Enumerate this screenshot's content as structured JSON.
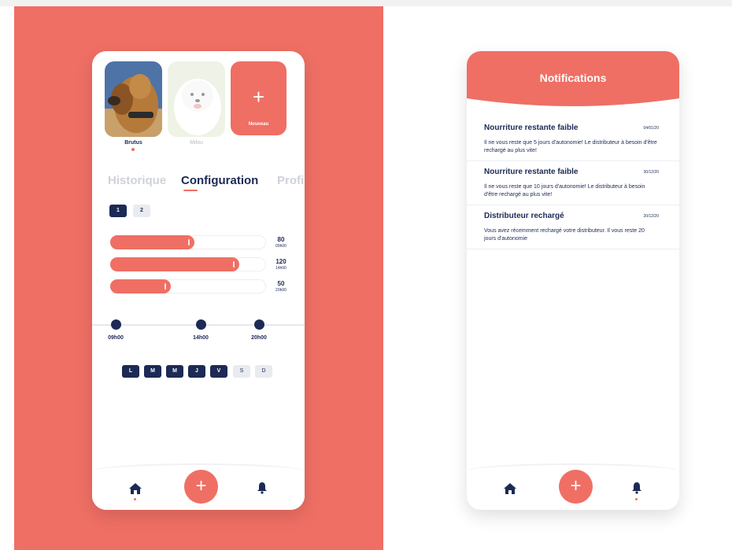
{
  "colors": {
    "accent": "#ef6f64",
    "navy": "#1c2a55",
    "muted": "#cfd2dc"
  },
  "config_screen": {
    "pets": [
      {
        "name": "Brutus",
        "selected": true
      },
      {
        "name": "Milou",
        "selected": false
      }
    ],
    "add_pet": {
      "icon": "plus-icon",
      "label": "Nouveau"
    },
    "tabs": [
      "Historique",
      "Configuration",
      "Profi"
    ],
    "pages": [
      "1",
      "2"
    ],
    "bars": [
      {
        "value": "80",
        "time": "09h00",
        "fill": 0.54
      },
      {
        "value": "120",
        "time": "14h00",
        "fill": 0.83
      },
      {
        "value": "50",
        "time": "20h00",
        "fill": 0.39
      }
    ],
    "timeline": [
      "09h00",
      "14h00",
      "20h00"
    ],
    "days": [
      {
        "label": "L",
        "active": true
      },
      {
        "label": "M",
        "active": true
      },
      {
        "label": "M",
        "active": true
      },
      {
        "label": "J",
        "active": true
      },
      {
        "label": "V",
        "active": true
      },
      {
        "label": "S",
        "active": false
      },
      {
        "label": "D",
        "active": false
      }
    ]
  },
  "notifications_screen": {
    "title": "Notifications",
    "items": [
      {
        "title": "Nourriture restante faible",
        "date": "04/01/20",
        "body": "Il ne vous reste que 5 jours d'autonomie! Le distributeur à besoin d'être rechargé au plus vite!"
      },
      {
        "title": "Nourriture restante faible",
        "date": "30/12/20",
        "body": "Il ne vous reste que 10 jours d'autonomie! Le distributeur à besoin d'être rechargé au plus vite!"
      },
      {
        "title": "Distributeur rechargé",
        "date": "20/12/20",
        "body": "Vous avez récemment rechargé votre distributeur. Il vous reste 20 jours d'autonomie"
      }
    ]
  },
  "nav": {
    "home_icon": "home-icon",
    "add_icon": "plus-icon",
    "bell_icon": "bell-icon",
    "add_label": "+"
  }
}
